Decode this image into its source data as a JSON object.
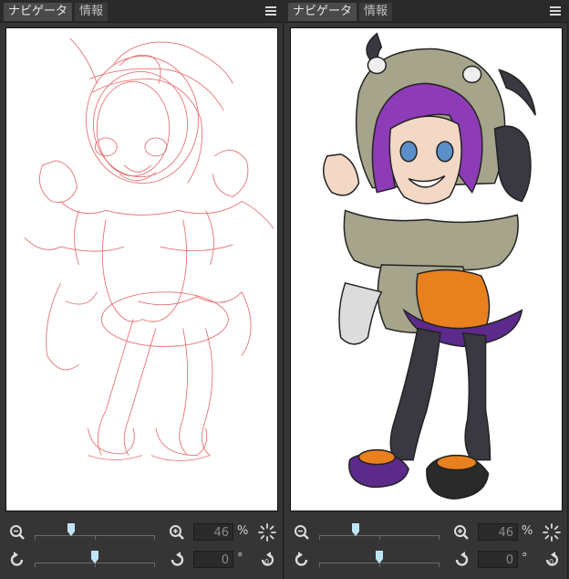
{
  "panels": [
    {
      "tabs": {
        "active": "ナビゲータ",
        "inactive": "情報"
      },
      "zoom": {
        "value": "46",
        "unit": "%",
        "slider_fraction": 0.3
      },
      "rotation": {
        "value": "0",
        "unit": "°",
        "slider_fraction": 0.5
      }
    },
    {
      "tabs": {
        "active": "ナビゲータ",
        "inactive": "情報"
      },
      "zoom": {
        "value": "46",
        "unit": "%",
        "slider_fraction": 0.3
      },
      "rotation": {
        "value": "0",
        "unit": "°",
        "slider_fraction": 0.5
      }
    }
  ],
  "colors": {
    "accent": "#bfe4f7",
    "sketch": "#e45a5a",
    "hair": "#8e3bb8",
    "hood": "#a6a58c",
    "leggings": "#3a3840",
    "shorts": "#e8801e"
  }
}
